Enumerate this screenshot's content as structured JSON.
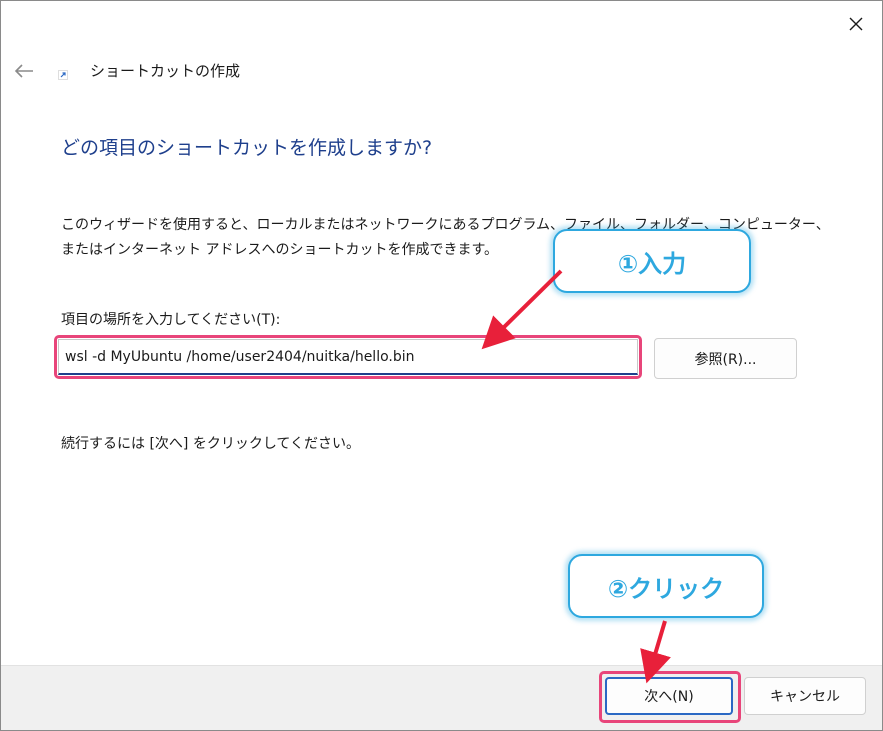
{
  "dialog": {
    "title": "ショートカットの作成",
    "heading": "どの項目のショートカットを作成しますか?",
    "description": "このウィザードを使用すると、ローカルまたはネットワークにあるプログラム、ファイル、フォルダー、コンピューター、またはインターネット アドレスへのショートカットを作成できます。",
    "field_label": "項目の場所を入力してください(T):",
    "location_value": "wsl -d MyUbuntu /home/user2404/nuitka/hello.bin",
    "browse_label": "参照(R)...",
    "instruction": "続行するには [次へ] をクリックしてください。"
  },
  "footer": {
    "next_label": "次へ(N)",
    "cancel_label": "キャンセル"
  },
  "annotations": {
    "callout_1": "①入力",
    "callout_2": "②クリック"
  },
  "colors": {
    "heading": "#1e3f8c",
    "highlight": "#e8457a",
    "callout_border": "#2ea8df",
    "arrow": "#e8203a"
  },
  "icons": [
    "close-icon",
    "back-arrow-icon",
    "shortcut-icon"
  ]
}
